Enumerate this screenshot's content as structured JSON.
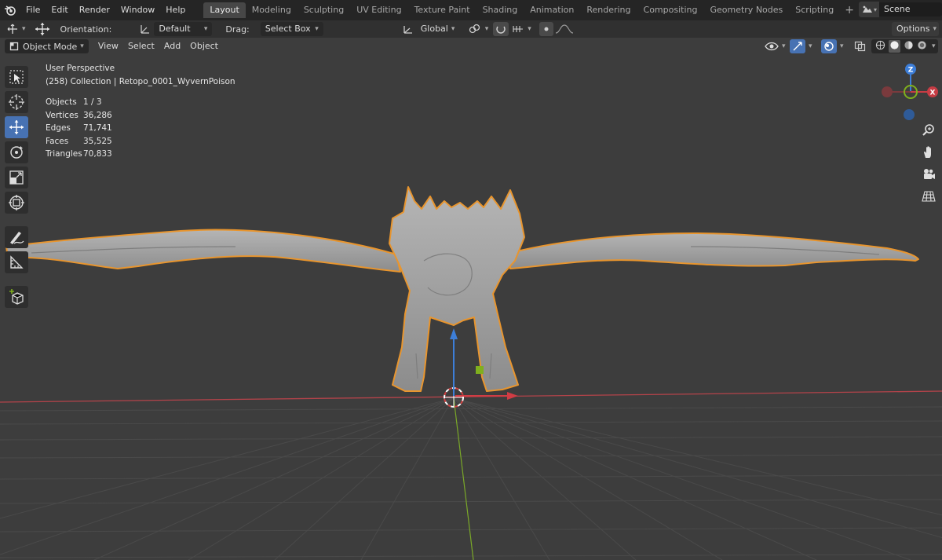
{
  "topbar": {
    "menu": [
      "File",
      "Edit",
      "Render",
      "Window",
      "Help"
    ],
    "workspaces": [
      "Layout",
      "Modeling",
      "Sculpting",
      "UV Editing",
      "Texture Paint",
      "Shading",
      "Animation",
      "Rendering",
      "Compositing",
      "Geometry Nodes",
      "Scripting"
    ],
    "active_workspace": "Layout",
    "add_workspace": "+",
    "scene_name": "Scene"
  },
  "toolheader": {
    "orientation_label": "Orientation:",
    "orientation_value": "Default",
    "drag_label": "Drag:",
    "drag_value": "Select Box",
    "transform_orientation": "Global",
    "options_label": "Options"
  },
  "viewheader": {
    "mode": "Object Mode",
    "menus": [
      "View",
      "Select",
      "Add",
      "Object"
    ]
  },
  "overlay": {
    "perspective": "User Perspective",
    "collection": "(258) Collection | Retopo_0001_WyvernPoison",
    "stats": [
      {
        "label": "Objects",
        "value": "1 / 3"
      },
      {
        "label": "Vertices",
        "value": "36,286"
      },
      {
        "label": "Edges",
        "value": "71,741"
      },
      {
        "label": "Faces",
        "value": "35,525"
      },
      {
        "label": "Triangles",
        "value": "70,833"
      }
    ]
  },
  "gizmo": {
    "z": "Z",
    "x": "X"
  },
  "colors": {
    "accent": "#4772b3",
    "selection_outline": "#e8952e",
    "axis_x": "#c63c44",
    "axis_y": "#7faf1e",
    "axis_z": "#3d7ed8",
    "grid": "#4a4a4a"
  }
}
